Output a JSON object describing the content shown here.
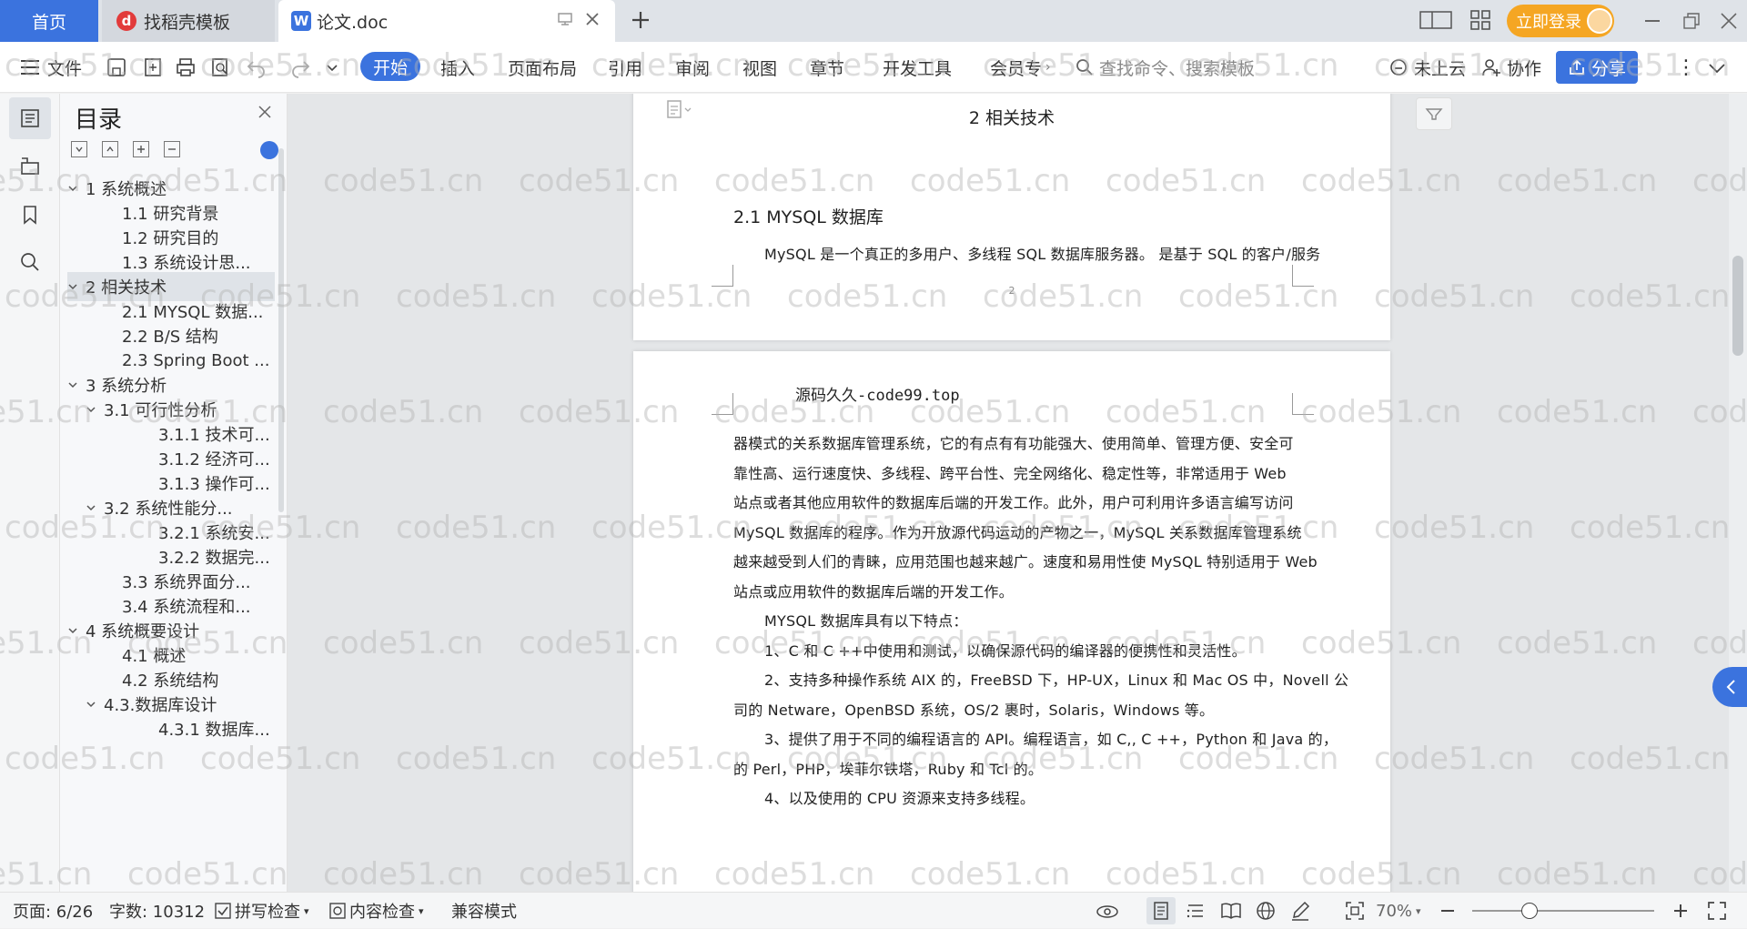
{
  "tabs": {
    "home": "首页",
    "daoke": "找稻壳模板",
    "doc": "论文.doc"
  },
  "titlebar": {
    "login": "立即登录"
  },
  "ribbon": {
    "file": "文件",
    "start": "开始",
    "insert": "插入",
    "layout": "页面布局",
    "reference": "引用",
    "review": "审阅",
    "view": "视图",
    "chapter": "章节",
    "devtools": "开发工具",
    "member": "会员专",
    "search_placeholder": "查找命令、搜索模板",
    "cloud": "未上云",
    "collab": "协作",
    "share": "分享"
  },
  "toc": {
    "title": "目录",
    "items": [
      {
        "label": "1 系统概述",
        "level": 1,
        "expand": "v"
      },
      {
        "label": "1.1  研究背景",
        "level": 2,
        "expand": ""
      },
      {
        "label": "1.2 研究目的",
        "level": 2,
        "expand": ""
      },
      {
        "label": "1.3 系统设计思...",
        "level": 2,
        "expand": ""
      },
      {
        "label": "2 相关技术",
        "level": 1,
        "expand": "v"
      },
      {
        "label": "2.1 MYSQL 数据...",
        "level": 2,
        "expand": ""
      },
      {
        "label": "2.2 B/S 结构",
        "level": 2,
        "expand": ""
      },
      {
        "label": "2.3 Spring Boot ...",
        "level": 2,
        "expand": ""
      },
      {
        "label": "3 系统分析",
        "level": 1,
        "expand": "v"
      },
      {
        "label": "3.1 可行性分析",
        "level": 2,
        "expand": "v"
      },
      {
        "label": "3.1.1 技术可...",
        "level": 3,
        "expand": ""
      },
      {
        "label": "3.1.2 经济可...",
        "level": 3,
        "expand": ""
      },
      {
        "label": "3.1.3 操作可...",
        "level": 3,
        "expand": ""
      },
      {
        "label": "3.2 系统性能分...",
        "level": 2,
        "expand": "v"
      },
      {
        "label": "3.2.1  系统安...",
        "level": 3,
        "expand": ""
      },
      {
        "label": "3.2.2  数据完...",
        "level": 3,
        "expand": ""
      },
      {
        "label": "3.3 系统界面分...",
        "level": 2,
        "expand": ""
      },
      {
        "label": "3.4 系统流程和...",
        "level": 2,
        "expand": ""
      },
      {
        "label": "4 系统概要设计",
        "level": 1,
        "expand": "v"
      },
      {
        "label": "4.1 概述",
        "level": 2,
        "expand": ""
      },
      {
        "label": "4.2 系统结构",
        "level": 2,
        "expand": ""
      },
      {
        "label": "4.3.数据库设计",
        "level": 2,
        "expand": "v"
      },
      {
        "label": "4.3.1 数据库...",
        "level": 3,
        "expand": ""
      }
    ],
    "selected_index": 4
  },
  "doc": {
    "header": "2 相关技术",
    "section_title": "2.1 MYSQL 数据库",
    "page1_line": "MySQL 是一个真正的多用户、多线程 SQL 数据库服务器。 是基于 SQL 的客户/服务",
    "page_number": "2",
    "page2_header": "源码久久-code99.top",
    "lines": [
      "器模式的关系数据库管理系统，它的有点有有功能强大、使用简单、管理方便、安全可",
      "靠性高、运行速度快、多线程、跨平台性、完全网络化、稳定性等，非常适用于 Web",
      "站点或者其他应用软件的数据库后端的开发工作。此外，用户可利用许多语言编写访问",
      "MySQL 数据库的程序。作为开放源代码运动的产物之一，MySQL 关系数据库管理系统",
      "越来越受到人们的青睐，应用范围也越来越广。速度和易用性使 MySQL 特别适用于 Web",
      "站点或应用软件的数据库后端的开发工作。",
      "    MYSQL 数据库具有以下特点：",
      "    1、C 和 C ++中使用和测试，以确保源代码的编译器的便携性和灵活性。",
      "    2、支持多种操作系统 AIX 的，FreeBSD 下，HP-UX，Linux 和 Mac OS 中，Novell 公",
      "司的 Netware，OpenBSD 系统，OS/2 裹时，Solaris，Windows 等。",
      "    3、提供了用于不同的编程语言的 API。编程语言，如 C,, C ++，Python 和 Java 的，",
      "的 Perl，PHP，埃菲尔铁塔，Ruby 和 Tcl 的。",
      "    4、以及使用的 CPU 资源来支持多线程。"
    ]
  },
  "status": {
    "page": "页面: 6/26",
    "words": "字数: 10312",
    "spell": "拼写检查",
    "content": "内容检查",
    "compat": "兼容模式",
    "zoom": "70%"
  },
  "watermark": "code51.cn",
  "colors": {
    "accent": "#3b73de",
    "login": "#f5a623"
  }
}
